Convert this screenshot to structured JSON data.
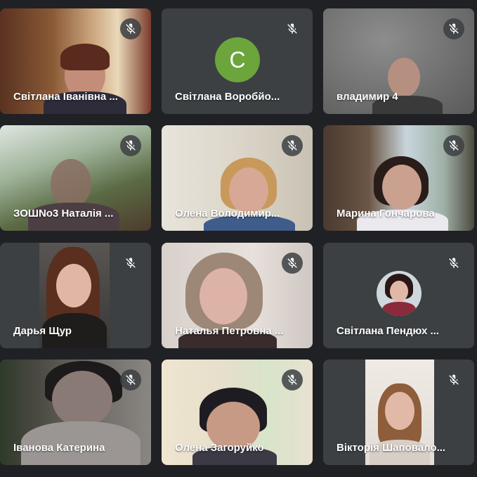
{
  "colors": {
    "background": "#202124",
    "tile": "#3c4043",
    "avatar_c": "#6ba53b"
  },
  "participants": [
    {
      "name": "Світлана Іванівна ...",
      "muted": true,
      "mute_icon": "mic-off-icon"
    },
    {
      "name": "Світлана Воробйо...",
      "muted": true,
      "avatar_letter": "C",
      "mute_icon": "mic-off-icon"
    },
    {
      "name": "владимир 4",
      "muted": true,
      "mute_icon": "mic-off-icon"
    },
    {
      "name": "ЗОШNо3 Наталія ...",
      "muted": true,
      "mute_icon": "mic-off-icon"
    },
    {
      "name": "Олена Володимир...",
      "muted": true,
      "mute_icon": "mic-off-icon"
    },
    {
      "name": "Марина Гончарова",
      "muted": true,
      "mute_icon": "mic-off-icon"
    },
    {
      "name": "Дарья Щур",
      "muted": true,
      "mute_icon": "mic-off-icon"
    },
    {
      "name": "Наталья Петровна ...",
      "muted": true,
      "mute_icon": "mic-off-icon"
    },
    {
      "name": "Світлана Пендюх ...",
      "muted": true,
      "avatar_photo": true,
      "mute_icon": "mic-off-icon"
    },
    {
      "name": "Іванова Катерина",
      "muted": true,
      "mute_icon": "mic-off-icon"
    },
    {
      "name": "Олена Загоруйко",
      "muted": true,
      "mute_icon": "mic-off-icon"
    },
    {
      "name": "Вікторія Шаповало...",
      "muted": true,
      "mute_icon": "mic-off-icon"
    }
  ]
}
